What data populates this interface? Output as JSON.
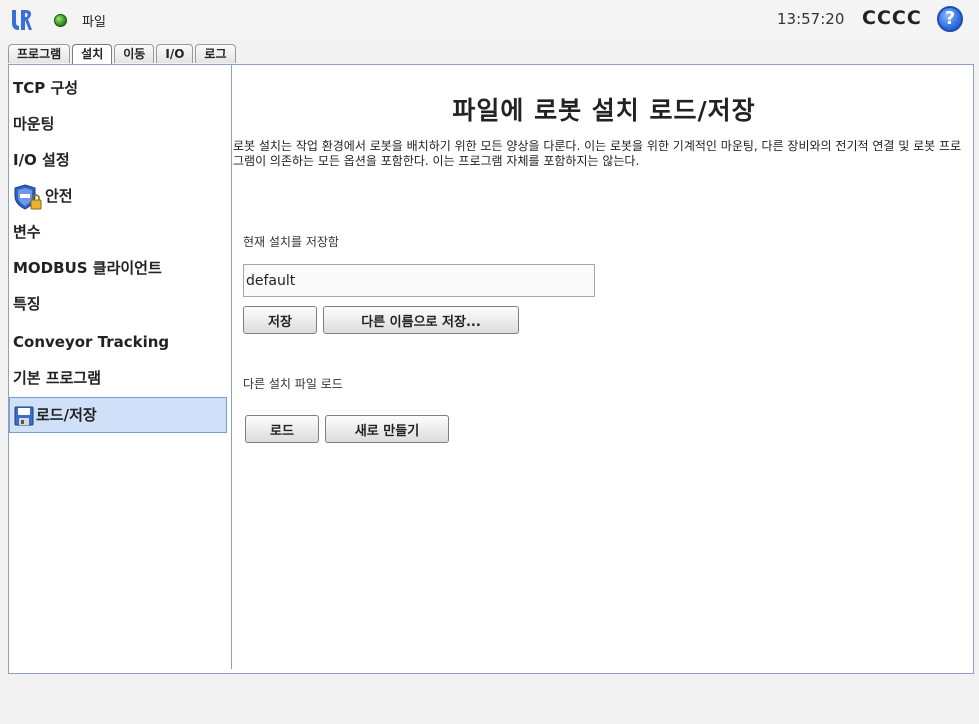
{
  "topbar": {
    "menu_file": "파일",
    "clock": "13:57:20",
    "robot_name": "CCCC",
    "help_label": "?"
  },
  "tabs": [
    {
      "label": "프로그램"
    },
    {
      "label": "설치"
    },
    {
      "label": "이동"
    },
    {
      "label": "I/O"
    },
    {
      "label": "로그"
    }
  ],
  "active_tab": "설치",
  "sidebar": {
    "items": [
      {
        "label": "TCP 구성"
      },
      {
        "label": "마운팅"
      },
      {
        "label": "I/O 설정"
      },
      {
        "label": "안전",
        "icon": "shield-lock-icon"
      },
      {
        "label": "변수"
      },
      {
        "label": "MODBUS 클라이언트"
      },
      {
        "label": "특징"
      },
      {
        "label": "Conveyor Tracking"
      },
      {
        "label": "기본 프로그램"
      },
      {
        "label": "로드/저장",
        "icon": "floppy-disk-icon"
      }
    ],
    "selected": "로드/저장"
  },
  "main": {
    "title": "파일에 로봇 설치 로드/저장",
    "description": "로봇 설치는 작업 환경에서 로봇을 배치하기 위한 모든 양상을 다룬다. 이는 로봇을 위한 기계적인 마운팅, 다른 장비와의 전기적 연결 및 로봇 프로그램이 의존하는 모든 옵션을 포함한다. 이는 프로그램 자체를 포함하지는 않는다.",
    "save_section_label": "현재 설치를 저장함",
    "filename_value": "default",
    "save_button": "저장",
    "save_as_button": "다른 이름으로 저장...",
    "load_section_label": "다른 설치 파일 로드",
    "load_button": "로드",
    "new_button": "새로 만들기"
  },
  "colors": {
    "status_ok": "#3c9a1e",
    "selection_bg": "#cfe0f8",
    "frame_border": "#8aa0c4",
    "help_blue": "#2f6fe0"
  }
}
